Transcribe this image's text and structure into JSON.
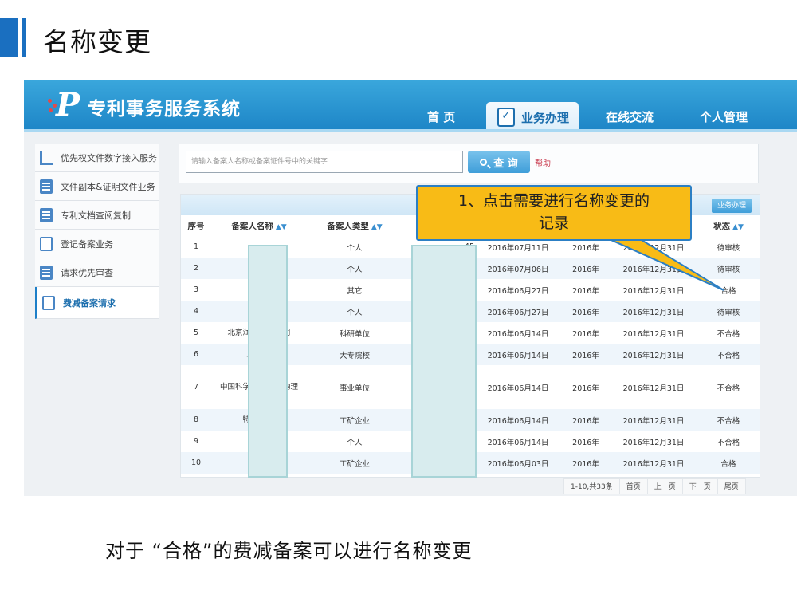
{
  "slide": {
    "title": "名称变更",
    "caption": "对于 “合格”的费减备案可以进行名称变更"
  },
  "app": {
    "logo_text": "专利事务服务系统",
    "nav": [
      {
        "label": "首 页"
      },
      {
        "label": "业务办理",
        "active": true
      },
      {
        "label": "在线交流"
      },
      {
        "label": "个人管理"
      }
    ],
    "sidebar": [
      {
        "label": "优先权文件数字接入服务",
        "icon": "crop-icon"
      },
      {
        "label": "文件副本&证明文件业务",
        "icon": "document-icon"
      },
      {
        "label": "专利文档查阅复制",
        "icon": "book-icon"
      },
      {
        "label": "登记备案业务",
        "icon": "page-icon"
      },
      {
        "label": "请求优先审查",
        "icon": "book-icon"
      },
      {
        "label": "费减备案请求",
        "icon": "page-icon",
        "active": true
      }
    ],
    "search": {
      "placeholder": "请输入备案人名称或备案证件号中的关键字",
      "button": "查 询",
      "help": "帮助"
    },
    "table": {
      "action_button": "业务办理",
      "columns": [
        "序号",
        "备案人名称",
        "备案人类型",
        "",
        "",
        "",
        "",
        "状态"
      ],
      "rows": [
        {
          "no": "1",
          "name": "",
          "type": "个人",
          "id_tail": "45",
          "date": "2016年07月11日",
          "year": "2016年",
          "end": "2016年12月31日",
          "status": "待审核"
        },
        {
          "no": "2",
          "name": "",
          "type": "个人",
          "id_tail": "",
          "date": "2016年07月06日",
          "year": "2016年",
          "end": "2016年12月31日",
          "status": "待审核"
        },
        {
          "no": "3",
          "name": "",
          "type": "其它",
          "id_tail": "",
          "date": "2016年06月27日",
          "year": "2016年",
          "end": "2016年12月31日",
          "status": "合格"
        },
        {
          "no": "4",
          "name": "",
          "type": "个人",
          "id_tail": "11",
          "date": "2016年06月27日",
          "year": "2016年",
          "end": "2016年12月31日",
          "status": "待审核"
        },
        {
          "no": "5",
          "name": "北京润泽 有限公司",
          "type": "科研单位",
          "id_tail": "",
          "date": "2016年06月14日",
          "year": "2016年",
          "end": "2016年12月31日",
          "status": "不合格"
        },
        {
          "no": "6",
          "name": "上 大学",
          "type": "大专院校",
          "id_tail": "",
          "date": "2016年06月14日",
          "year": "2016年",
          "end": "2016年12月31日",
          "status": "不合格"
        },
        {
          "no": "7",
          "name": "中国科学院 机械与物理",
          "type": "事业单位",
          "id_tail": "",
          "date": "2016年06月14日",
          "year": "2016年",
          "end": "2016年12月31日",
          "status": "不合格"
        },
        {
          "no": "8",
          "name": "特实 公司",
          "type": "工矿企业",
          "id_tail": "",
          "date": "2016年06月14日",
          "year": "2016年",
          "end": "2016年12月31日",
          "status": "不合格"
        },
        {
          "no": "9",
          "name": "",
          "type": "个人",
          "id_tail": "",
          "date": "2016年06月14日",
          "year": "2016年",
          "end": "2016年12月31日",
          "status": "不合格"
        },
        {
          "no": "10",
          "name": "",
          "type": "工矿企业",
          "id_tail": "",
          "date": "2016年06月03日",
          "year": "2016年",
          "end": "2016年12月31日",
          "status": "合格"
        }
      ]
    },
    "pager": [
      "1-10,共33条",
      "首页",
      "上一页",
      "下一页",
      "尾页"
    ]
  },
  "callout": {
    "line1": "1、点击需要进行名称变更的",
    "line2": "记录"
  },
  "colors": {
    "accent": "#1a6fc0",
    "callout": "#f8bb16",
    "topbar": "#2a95d2"
  }
}
